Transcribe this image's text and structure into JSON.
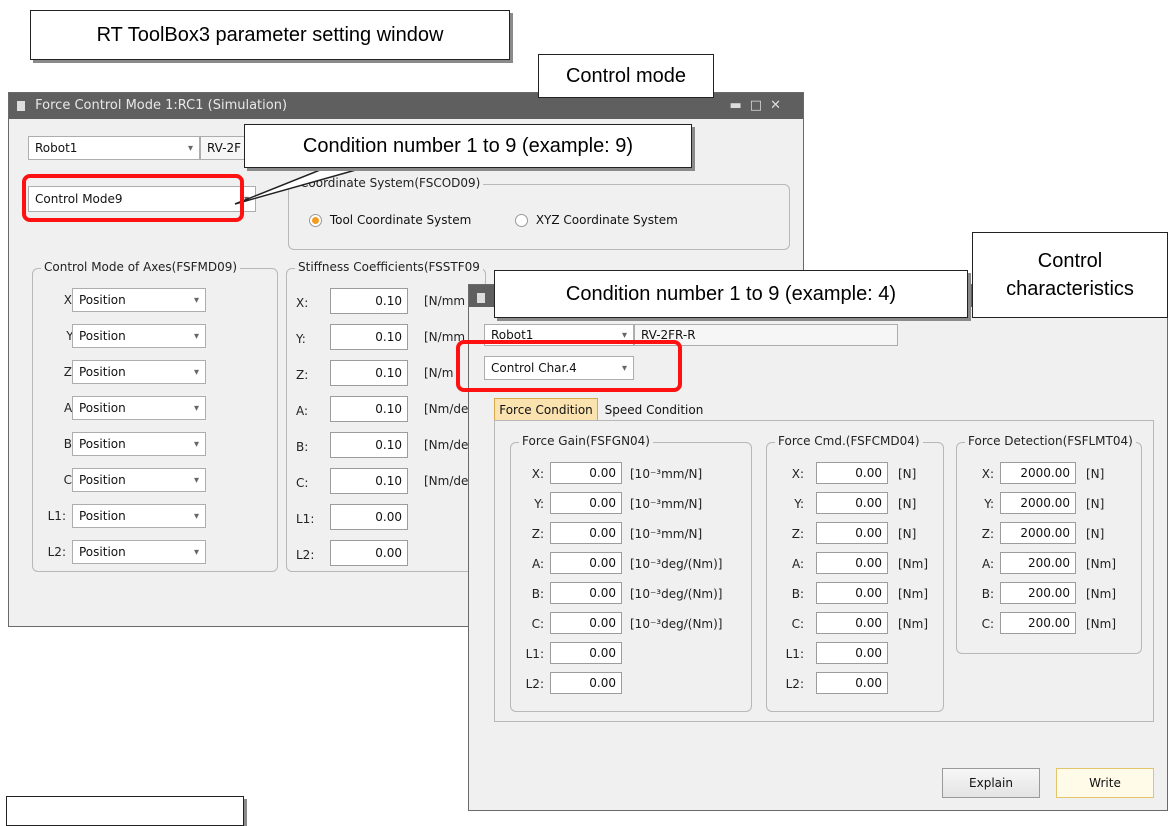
{
  "callouts": {
    "top_title": "RT ToolBox3 parameter setting window",
    "control_mode": "Control mode",
    "condition_9": "Condition number 1 to 9 (example: 9)",
    "condition_4": "Condition number 1 to 9 (example: 4)",
    "control_characteristics": "Control characteristics"
  },
  "window1": {
    "title": "Force Control Mode 1:RC1  (Simulation)",
    "robot": "Robot1",
    "robot_model": "RV-2F",
    "mode_select": "Control Mode9",
    "coord_group": "Coordinate System(FSCOD09)",
    "coord_tool": "Tool Coordinate System",
    "coord_xyz": "XYZ Coordinate System",
    "axes_group": "Control Mode of Axes(FSFMD09)",
    "axes": [
      {
        "label": "X:",
        "value": "Position"
      },
      {
        "label": "Y:",
        "value": "Position"
      },
      {
        "label": "Z:",
        "value": "Position"
      },
      {
        "label": "A:",
        "value": "Position"
      },
      {
        "label": "B:",
        "value": "Position"
      },
      {
        "label": "C:",
        "value": "Position"
      },
      {
        "label": "L1:",
        "value": "Position"
      },
      {
        "label": "L2:",
        "value": "Position"
      }
    ],
    "stiff_group": "Stiffness Coefficients(FSSTF09",
    "stiff": [
      {
        "label": "X:",
        "value": "0.10",
        "unit": "[N/mm"
      },
      {
        "label": "Y:",
        "value": "0.10",
        "unit": "[N/mm"
      },
      {
        "label": "Z:",
        "value": "0.10",
        "unit": "[N/m"
      },
      {
        "label": "A:",
        "value": "0.10",
        "unit": "[Nm/de"
      },
      {
        "label": "B:",
        "value": "0.10",
        "unit": "[Nm/de"
      },
      {
        "label": "C:",
        "value": "0.10",
        "unit": "[Nm/de"
      },
      {
        "label": "L1:",
        "value": "0.00",
        "unit": ""
      },
      {
        "label": "L2:",
        "value": "0.00",
        "unit": ""
      }
    ]
  },
  "window2": {
    "robot": "Robot1",
    "robot_model": "RV-2FR-R",
    "char_select": "Control Char.4",
    "tab_force": "Force Condition",
    "tab_speed": "Speed Condition",
    "gain_group": "Force Gain(FSFGN04)",
    "gain": [
      {
        "label": "X:",
        "value": "0.00",
        "unit": "[10⁻³mm/N]"
      },
      {
        "label": "Y:",
        "value": "0.00",
        "unit": "[10⁻³mm/N]"
      },
      {
        "label": "Z:",
        "value": "0.00",
        "unit": "[10⁻³mm/N]"
      },
      {
        "label": "A:",
        "value": "0.00",
        "unit": "[10⁻³deg/(Nm)]"
      },
      {
        "label": "B:",
        "value": "0.00",
        "unit": "[10⁻³deg/(Nm)]"
      },
      {
        "label": "C:",
        "value": "0.00",
        "unit": "[10⁻³deg/(Nm)]"
      },
      {
        "label": "L1:",
        "value": "0.00",
        "unit": ""
      },
      {
        "label": "L2:",
        "value": "0.00",
        "unit": ""
      }
    ],
    "cmd_group": "Force Cmd.(FSFCMD04)",
    "cmd": [
      {
        "label": "X:",
        "value": "0.00",
        "unit": "[N]"
      },
      {
        "label": "Y:",
        "value": "0.00",
        "unit": "[N]"
      },
      {
        "label": "Z:",
        "value": "0.00",
        "unit": "[N]"
      },
      {
        "label": "A:",
        "value": "0.00",
        "unit": "[Nm]"
      },
      {
        "label": "B:",
        "value": "0.00",
        "unit": "[Nm]"
      },
      {
        "label": "C:",
        "value": "0.00",
        "unit": "[Nm]"
      },
      {
        "label": "L1:",
        "value": "0.00",
        "unit": ""
      },
      {
        "label": "L2:",
        "value": "0.00",
        "unit": ""
      }
    ],
    "det_group": "Force Detection(FSFLMT04)",
    "det": [
      {
        "label": "X:",
        "value": "2000.00",
        "unit": "[N]"
      },
      {
        "label": "Y:",
        "value": "2000.00",
        "unit": "[N]"
      },
      {
        "label": "Z:",
        "value": "2000.00",
        "unit": "[N]"
      },
      {
        "label": "A:",
        "value": "200.00",
        "unit": "[Nm]"
      },
      {
        "label": "B:",
        "value": "200.00",
        "unit": "[Nm]"
      },
      {
        "label": "C:",
        "value": "200.00",
        "unit": "[Nm]"
      }
    ],
    "explain_button": "Explain",
    "write_button": "Write"
  }
}
